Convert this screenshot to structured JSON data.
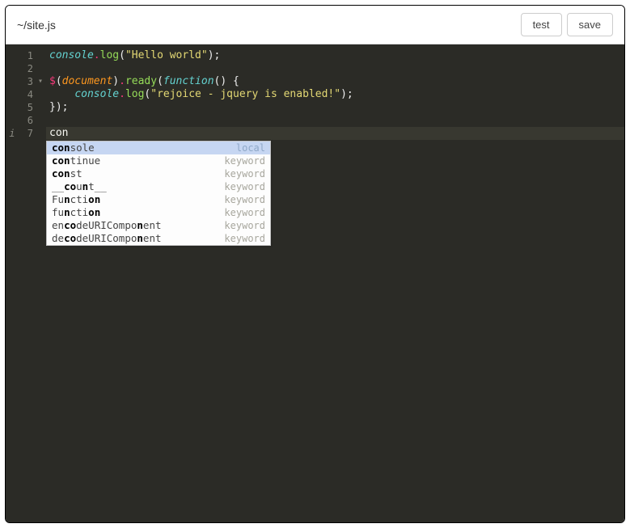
{
  "header": {
    "file_path": "~/site.js",
    "test_label": "test",
    "save_label": "save"
  },
  "gutter": [
    {
      "num": "1",
      "icon": "",
      "fold": ""
    },
    {
      "num": "2",
      "icon": "",
      "fold": ""
    },
    {
      "num": "3",
      "icon": "",
      "fold": "▾"
    },
    {
      "num": "4",
      "icon": "",
      "fold": ""
    },
    {
      "num": "5",
      "icon": "",
      "fold": ""
    },
    {
      "num": "6",
      "icon": "",
      "fold": ""
    },
    {
      "num": "7",
      "icon": "i",
      "fold": ""
    }
  ],
  "code": {
    "l1": {
      "console": "console",
      "dot": ".",
      "log": "log",
      "lp": "(",
      "str": "\"Hello world\"",
      "rp": ")",
      "semi": ";"
    },
    "l2": {
      "blank": ""
    },
    "l3": {
      "dollar": "$",
      "lp1": "(",
      "doc": "document",
      "rp1": ")",
      "dot": ".",
      "ready": "ready",
      "lp2": "(",
      "func": "function",
      "lp3": "(",
      "rp3": ")",
      "sp": " ",
      "brace": "{"
    },
    "l4": {
      "indent": "    ",
      "console": "console",
      "dot": ".",
      "log": "log",
      "lp": "(",
      "str": "\"rejoice - jquery is enabled!\"",
      "rp": ")",
      "semi": ";"
    },
    "l5": {
      "close": "});"
    },
    "l6": {
      "blank": ""
    },
    "l7": {
      "typed": "con"
    }
  },
  "autocomplete": {
    "items": [
      {
        "pre": "con",
        "mid": "",
        "post": "sole",
        "kind": "local",
        "selected": true
      },
      {
        "pre": "con",
        "mid": "",
        "post": "tinue",
        "kind": "keyword",
        "selected": false
      },
      {
        "pre": "con",
        "mid": "",
        "post": "st",
        "kind": "keyword",
        "selected": false
      },
      {
        "pre": "__",
        "mid": "co",
        "post_mid": "u",
        "bold2": "n",
        "post": "t__",
        "kind": "keyword",
        "selected": false
      },
      {
        "pre": "Fu",
        "mid": "",
        "bold1": "n",
        "post_mid": "cti",
        "bold2": "on",
        "post": "",
        "kind": "keyword",
        "selected": false
      },
      {
        "pre": "fu",
        "mid": "",
        "bold1": "n",
        "post_mid": "cti",
        "bold2": "on",
        "post": "",
        "kind": "keyword",
        "selected": false
      },
      {
        "pre": "en",
        "mid": "",
        "bold1": "co",
        "post_mid": "deURICompo",
        "bold2": "n",
        "post": "ent",
        "kind": "keyword",
        "selected": false
      },
      {
        "pre": "de",
        "mid": "",
        "bold1": "co",
        "post_mid": "deURICompo",
        "bold2": "n",
        "post": "ent",
        "kind": "keyword",
        "selected": false
      }
    ]
  }
}
